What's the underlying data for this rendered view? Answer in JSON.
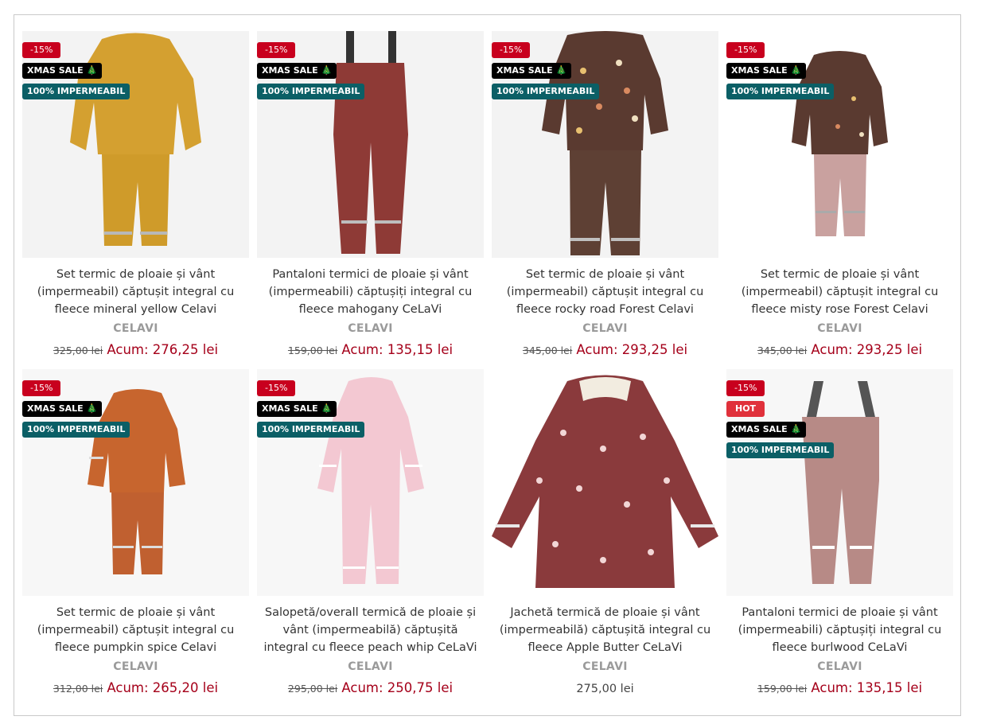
{
  "products": [
    {
      "badges": {
        "sale": "-15%",
        "xmas": "XMAS SALE 🎄",
        "imp": "100% IMPERMEABIL"
      },
      "title": "Set termic de ploaie și vânt (impermeabil) căptușit integral cu fleece mineral yellow Celavi",
      "brand": "CELAVI",
      "old_price": "325,00 lei",
      "new_price": "Acum: 276,25 lei",
      "color": "#d4a030"
    },
    {
      "badges": {
        "sale": "-15%",
        "xmas": "XMAS SALE 🎄",
        "imp": "100% IMPERMEABIL"
      },
      "title": "Pantaloni termici de ploaie și vânt (impermeabili) căptușiți integral cu fleece mahogany CeLaVi",
      "brand": "CELAVI",
      "old_price": "159,00 lei",
      "new_price": "Acum: 135,15 lei",
      "color": "#8e3a36"
    },
    {
      "badges": {
        "sale": "-15%",
        "xmas": "XMAS SALE 🎄",
        "imp": "100% IMPERMEABIL"
      },
      "title": "Set termic de ploaie și vânt (impermeabil) căptușit integral cu fleece rocky road Forest Celavi",
      "brand": "CELAVI",
      "old_price": "345,00 lei",
      "new_price": "Acum: 293,25 lei",
      "color": "#5a3a30"
    },
    {
      "badges": {
        "sale": "-15%",
        "xmas": "XMAS SALE 🎄",
        "imp": "100% IMPERMEABIL"
      },
      "title": "Set termic de ploaie și vânt (impermeabil) căptușit integral cu fleece misty rose Forest Celavi",
      "brand": "CELAVI",
      "old_price": "345,00 lei",
      "new_price": "Acum: 293,25 lei",
      "color": "#c9a19f"
    },
    {
      "badges": {
        "sale": "-15%",
        "xmas": "XMAS SALE 🎄",
        "imp": "100% IMPERMEABIL"
      },
      "title": "Set termic de ploaie și vânt (impermeabil) căptușit integral cu fleece pumpkin spice Celavi",
      "brand": "CELAVI",
      "old_price": "312,00 lei",
      "new_price": "Acum: 265,20 lei",
      "color": "#c7652e"
    },
    {
      "badges": {
        "sale": "-15%",
        "xmas": "XMAS SALE 🎄",
        "imp": "100% IMPERMEABIL"
      },
      "title": "Salopetă/overall termică de ploaie și vânt (impermeabilă) căptușită integral cu fleece peach whip CeLaVi",
      "brand": "CELAVI",
      "old_price": "295,00 lei",
      "new_price": "Acum: 250,75 lei",
      "color": "#f3c8d2"
    },
    {
      "badges": {},
      "title": "Jachetă termică de ploaie și vânt (impermeabilă) căptușită integral cu fleece Apple Butter CeLaVi",
      "brand": "CELAVI",
      "price": "275,00 lei",
      "color": "#8a3a3c"
    },
    {
      "badges": {
        "sale": "-15%",
        "hot": "HOT",
        "xmas": "XMAS SALE 🎄",
        "imp": "100% IMPERMEABIL"
      },
      "title": "Pantaloni termici de ploaie și vânt (impermeabili) căptușiți integral cu fleece burlwood CeLaVi",
      "brand": "CELAVI",
      "old_price": "159,00 lei",
      "new_price": "Acum: 135,15 lei",
      "color": "#b78a86"
    }
  ]
}
